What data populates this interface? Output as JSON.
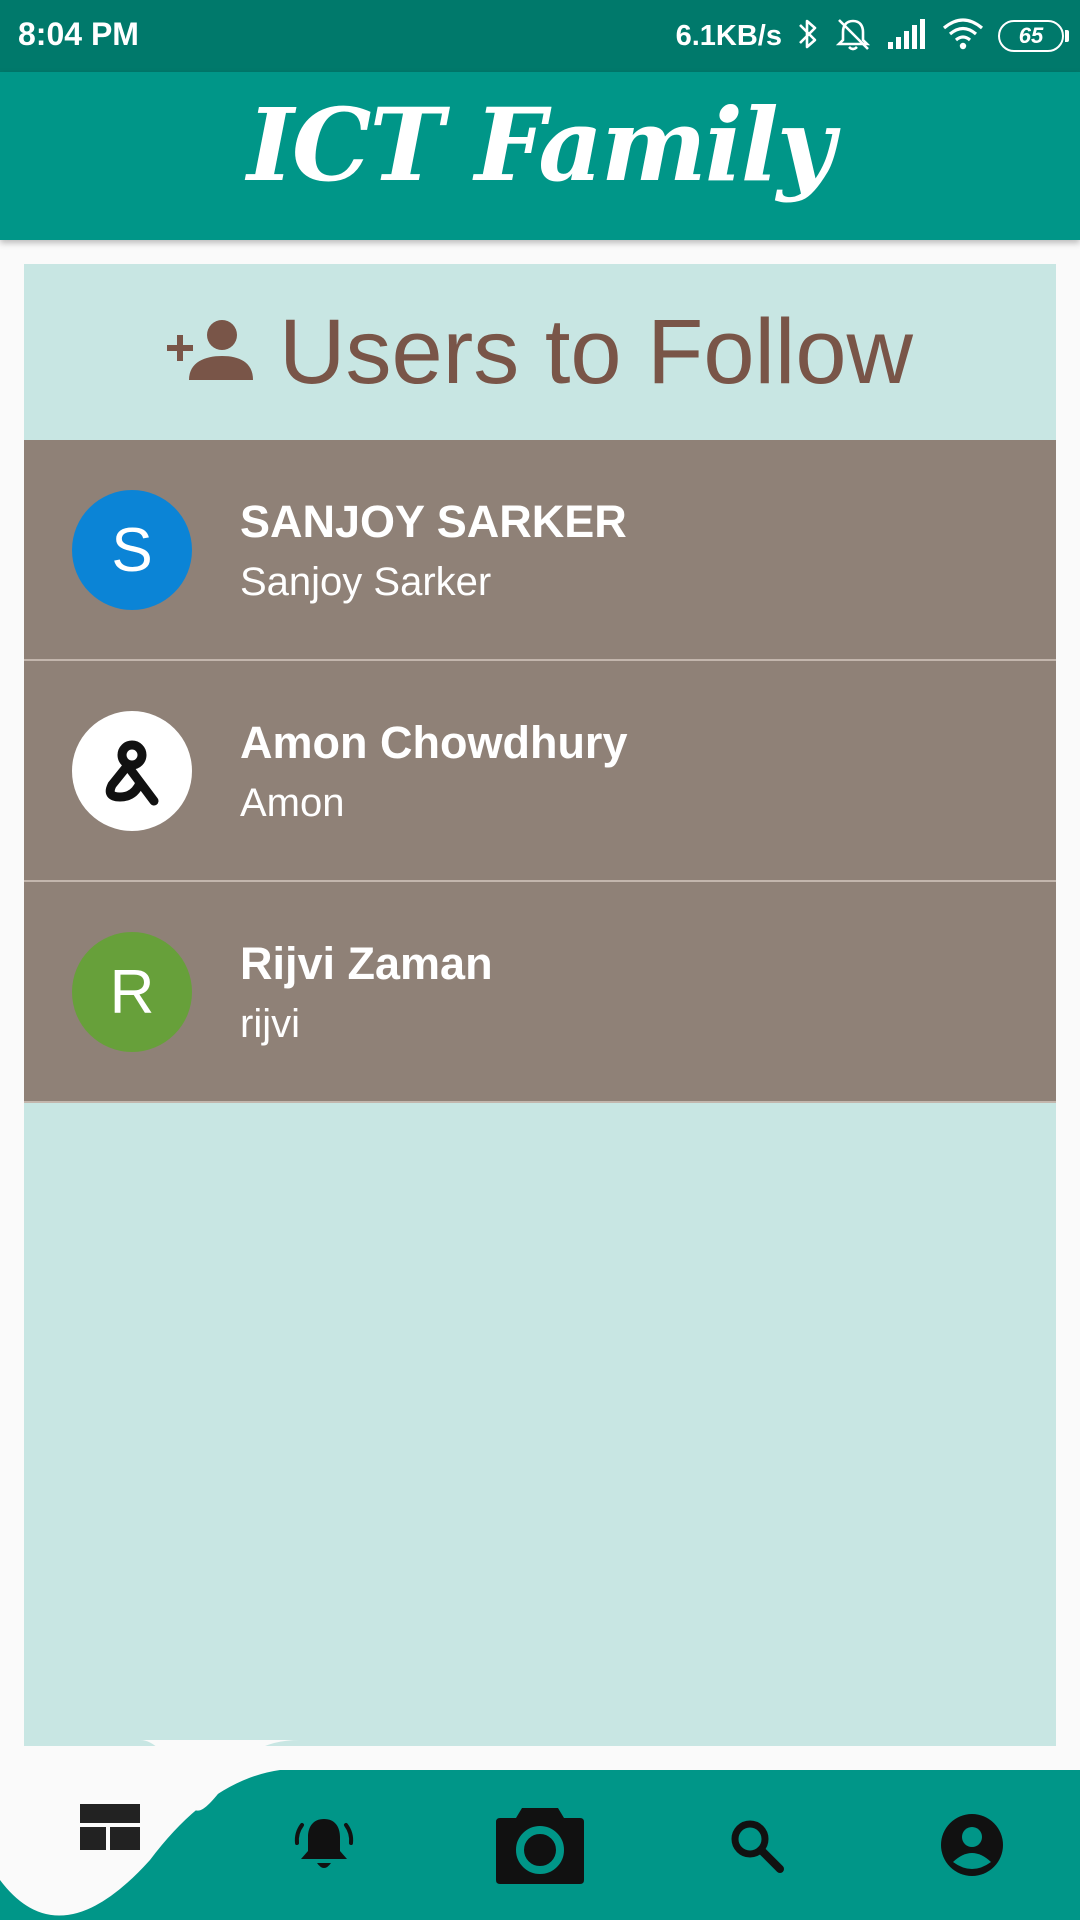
{
  "status_bar": {
    "time": "8:04 PM",
    "net_speed": "6.1KB/s",
    "battery": "65",
    "icons": [
      "bluetooth-icon",
      "alarm-off-icon",
      "signal-icon",
      "wifi-icon",
      "battery-icon"
    ]
  },
  "app_bar": {
    "title": "ICT Family"
  },
  "section": {
    "title": "Users to Follow",
    "icon": "person-add-icon"
  },
  "users": [
    {
      "name": "SANJOY SARKER",
      "handle": "Sanjoy Sarker",
      "avatar_letter": "S",
      "avatar_color": "#0b84d6"
    },
    {
      "name": "Amon Chowdhury",
      "handle": "Amon",
      "avatar_letter": "",
      "avatar_color": "#ffffff"
    },
    {
      "name": "Rijvi Zaman",
      "handle": "rijvi",
      "avatar_letter": "R",
      "avatar_color": "#67a03a"
    }
  ],
  "bottom_nav": {
    "items": [
      "feed-icon",
      "bell-icon",
      "camera-icon",
      "search-icon",
      "account-icon"
    ],
    "selected": "feed-icon"
  },
  "colors": {
    "primary": "#009688",
    "primary_dark": "#00796b",
    "panel_bg": "#c8e6e3",
    "row_bg": "#8f8177",
    "accent_text": "#795548"
  }
}
